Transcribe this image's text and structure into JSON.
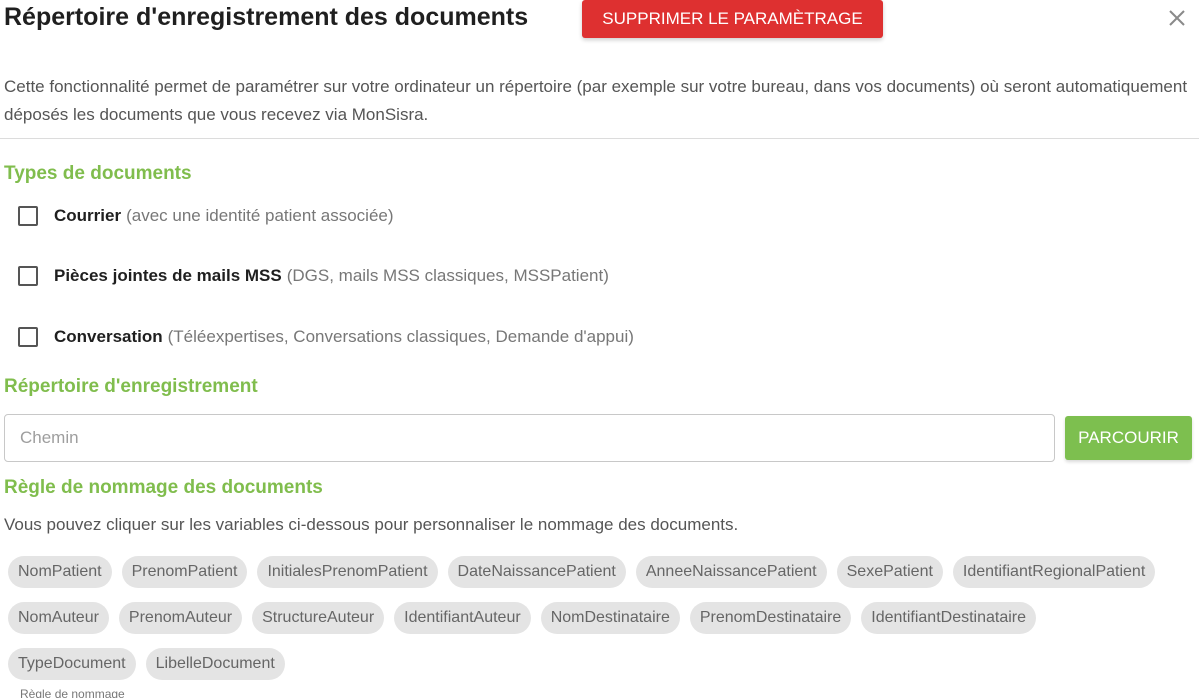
{
  "dialog": {
    "title": "Répertoire d'enregistrement des documents",
    "delete_button": "Supprimer le paramètrage",
    "close_icon": "close-icon",
    "intro": "Cette fonctionnalité permet de paramétrer sur votre ordinateur un répertoire (par exemple sur votre bureau, dans vos documents) où seront automatiquement déposés les documents que vous recevez via MonSisra."
  },
  "colors": {
    "accent_green": "#80bd4d",
    "danger_red": "#de3030",
    "chip_bg": "#e4e4e4"
  },
  "types": {
    "title": "Types de documents",
    "items": [
      {
        "label": "Courrier",
        "hint": "(avec une identité patient associée)",
        "checked": false
      },
      {
        "label": "Pièces jointes de mails MSS",
        "hint": "(DGS, mails MSS classiques, MSSPatient)",
        "checked": false
      },
      {
        "label": "Conversation",
        "hint": "(Téléexpertises, Conversations classiques, Demande d'appui)",
        "checked": false
      }
    ]
  },
  "directory": {
    "title": "Répertoire d'enregistrement",
    "placeholder": "Chemin",
    "value": "",
    "browse_button": "Parcourir"
  },
  "naming": {
    "title": "Règle de nommage des documents",
    "description": "Vous pouvez cliquer sur les variables ci-dessous pour personnaliser le nommage des documents.",
    "variables": [
      [
        "NomPatient",
        "PrenomPatient",
        "InitialesPrenomPatient",
        "DateNaissancePatient",
        "AnneeNaissancePatient",
        "SexePatient",
        "IdentifiantRegionalPatient"
      ],
      [
        "NomAuteur",
        "PrenomAuteur",
        "StructureAuteur",
        "IdentifiantAuteur",
        "NomDestinataire",
        "PrenomDestinataire",
        "IdentifiantDestinataire"
      ],
      [
        "TypeDocument",
        "LibelleDocument"
      ]
    ],
    "field_label": "Règle de nommage"
  }
}
